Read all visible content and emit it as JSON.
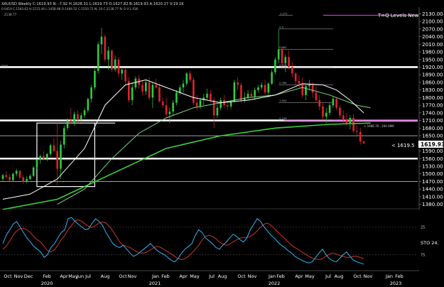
{
  "header": {
    "symbol_line": "XAUUSD Weekly  C:1619.93  N: -7.92  H:1628.31  L:1619.73  O:1627.82  B:1619.93  A:1620.27  V:19.1K",
    "ohlc_line": "0:0419  C:1583.63  H:1515.44  L:1458.98  O:1484.52  C:1550.71  N: 10  C:2138.77  N: 0  V:1.41K",
    "level_label": "2138.77"
  },
  "chart_title": "T=Q Levels New",
  "current_price_label": "< 1619.5",
  "current_price_box": "1619.93",
  "sma_label": "< 1686.76 - 200 SMA",
  "left_marker": "1900",
  "fib_labels": [
    "1.272",
    "0.5",
    "0.382",
    "0.618",
    "0.786",
    "1.000",
    "0.236"
  ],
  "stochastic_label": "STO 24.",
  "colors": {
    "background": "#000000",
    "up_candle": "#2ecc40",
    "down_candle": "#e0242c",
    "sma_fast": "#ffffff",
    "sma_mid": "#7fd77f",
    "sma_slow": "#3ad03a",
    "level_line": "#ffffff",
    "magenta_line": "#cc33cc",
    "stoch_k": "#29b6f6",
    "stoch_d": "#d32f2f"
  },
  "chart_data": {
    "type": "candlestick",
    "title": "T=Q Levels New",
    "symbol": "XAUUSD",
    "timeframe": "Weekly",
    "y_ticks": [
      2130,
      2100,
      2070,
      2040,
      2010,
      1980,
      1950,
      1920,
      1890,
      1860,
      1830,
      1800,
      1770,
      1740,
      1710,
      1680,
      1650,
      1620,
      1590,
      1560,
      1530,
      1500,
      1470,
      1440,
      1410,
      1380
    ],
    "ylim": [
      1365,
      2145
    ],
    "x_tick_labels": [
      "Oct",
      "Nov",
      "Dec",
      "Feb",
      "Apr",
      "May",
      "Jun",
      "Jul",
      "Aug",
      "Oct",
      "Nov",
      "Jan",
      "Feb",
      "Apr",
      "May",
      "Jul",
      "Aug",
      "Oct",
      "Nov",
      "Jan",
      "Feb",
      "Apr",
      "May",
      "Jul",
      "Aug",
      "Oct",
      "Nov",
      "Jan",
      "Feb"
    ],
    "year_labels": [
      "2020",
      "2021",
      "2022",
      "2023"
    ],
    "horizontal_levels": [
      1920,
      1710,
      1650,
      1560,
      1470
    ],
    "magenta_levels": [
      2124,
      1712
    ],
    "fib_levels": [
      2070,
      1990,
      1920,
      1850,
      1780,
      1710
    ],
    "boxes": [
      {
        "name": "box-2020-consolidation-left",
        "price_top": 1700,
        "price_bottom": 1450
      },
      {
        "name": "box-2020-consolidation-right",
        "price_top": 1700,
        "price_bottom": 1610
      }
    ],
    "ohlc": [
      [
        1480,
        1500,
        1470,
        1495
      ],
      [
        1495,
        1510,
        1480,
        1488
      ],
      [
        1488,
        1500,
        1470,
        1475
      ],
      [
        1475,
        1505,
        1470,
        1500
      ],
      [
        1500,
        1520,
        1490,
        1512
      ],
      [
        1512,
        1515,
        1480,
        1486
      ],
      [
        1486,
        1495,
        1460,
        1470
      ],
      [
        1470,
        1490,
        1462,
        1480
      ],
      [
        1480,
        1498,
        1475,
        1492
      ],
      [
        1492,
        1530,
        1488,
        1525
      ],
      [
        1525,
        1560,
        1520,
        1555
      ],
      [
        1555,
        1575,
        1540,
        1570
      ],
      [
        1570,
        1590,
        1555,
        1560
      ],
      [
        1560,
        1582,
        1550,
        1578
      ],
      [
        1578,
        1620,
        1570,
        1612
      ],
      [
        1612,
        1640,
        1585,
        1590
      ],
      [
        1590,
        1700,
        1455,
        1520
      ],
      [
        1520,
        1630,
        1480,
        1615
      ],
      [
        1615,
        1690,
        1600,
        1680
      ],
      [
        1680,
        1720,
        1670,
        1710
      ],
      [
        1710,
        1760,
        1695,
        1700
      ],
      [
        1700,
        1745,
        1690,
        1735
      ],
      [
        1735,
        1750,
        1700,
        1712
      ],
      [
        1712,
        1740,
        1705,
        1730
      ],
      [
        1730,
        1760,
        1720,
        1750
      ],
      [
        1750,
        1800,
        1740,
        1795
      ],
      [
        1795,
        1850,
        1780,
        1840
      ],
      [
        1840,
        1920,
        1830,
        1905
      ],
      [
        1905,
        2020,
        1895,
        2010
      ],
      [
        2010,
        2075,
        1970,
        2040
      ],
      [
        2040,
        2050,
        1940,
        1950
      ],
      [
        1950,
        2000,
        1910,
        1985
      ],
      [
        1985,
        1990,
        1900,
        1910
      ],
      [
        1910,
        1965,
        1900,
        1950
      ],
      [
        1950,
        1960,
        1880,
        1895
      ],
      [
        1895,
        1920,
        1870,
        1910
      ],
      [
        1910,
        1915,
        1850,
        1865
      ],
      [
        1865,
        1880,
        1780,
        1790
      ],
      [
        1790,
        1860,
        1770,
        1840
      ],
      [
        1840,
        1885,
        1830,
        1875
      ],
      [
        1875,
        1890,
        1835,
        1850
      ],
      [
        1850,
        1870,
        1810,
        1825
      ],
      [
        1825,
        1870,
        1810,
        1860
      ],
      [
        1860,
        1880,
        1790,
        1800
      ],
      [
        1800,
        1860,
        1760,
        1850
      ],
      [
        1850,
        1875,
        1835,
        1840
      ],
      [
        1840,
        1855,
        1780,
        1785
      ],
      [
        1785,
        1800,
        1760,
        1770
      ],
      [
        1770,
        1800,
        1720,
        1735
      ],
      [
        1735,
        1760,
        1700,
        1745
      ],
      [
        1745,
        1790,
        1730,
        1780
      ],
      [
        1780,
        1830,
        1770,
        1820
      ],
      [
        1820,
        1850,
        1810,
        1840
      ],
      [
        1840,
        1870,
        1820,
        1855
      ],
      [
        1855,
        1900,
        1845,
        1895
      ],
      [
        1895,
        1905,
        1860,
        1870
      ],
      [
        1870,
        1880,
        1770,
        1780
      ],
      [
        1780,
        1810,
        1750,
        1765
      ],
      [
        1765,
        1800,
        1755,
        1790
      ],
      [
        1790,
        1815,
        1770,
        1800
      ],
      [
        1800,
        1835,
        1790,
        1815
      ],
      [
        1815,
        1830,
        1780,
        1790
      ],
      [
        1790,
        1800,
        1680,
        1730
      ],
      [
        1730,
        1775,
        1720,
        1760
      ],
      [
        1760,
        1800,
        1750,
        1790
      ],
      [
        1790,
        1810,
        1760,
        1770
      ],
      [
        1770,
        1785,
        1750,
        1765
      ],
      [
        1765,
        1790,
        1755,
        1785
      ],
      [
        1785,
        1870,
        1780,
        1860
      ],
      [
        1860,
        1880,
        1830,
        1850
      ],
      [
        1850,
        1860,
        1780,
        1790
      ],
      [
        1790,
        1820,
        1780,
        1800
      ],
      [
        1800,
        1830,
        1790,
        1815
      ],
      [
        1815,
        1830,
        1800,
        1805
      ],
      [
        1805,
        1840,
        1790,
        1830
      ],
      [
        1830,
        1850,
        1820,
        1840
      ],
      [
        1840,
        1860,
        1830,
        1850
      ],
      [
        1850,
        1870,
        1810,
        1820
      ],
      [
        1820,
        1860,
        1800,
        1855
      ],
      [
        1855,
        1910,
        1850,
        1900
      ],
      [
        1900,
        1960,
        1890,
        1950
      ],
      [
        1950,
        2070,
        1935,
        1990
      ],
      [
        1990,
        2000,
        1920,
        1935
      ],
      [
        1935,
        1970,
        1900,
        1960
      ],
      [
        1960,
        1985,
        1910,
        1920
      ],
      [
        1920,
        1940,
        1880,
        1895
      ],
      [
        1895,
        1900,
        1850,
        1865
      ],
      [
        1865,
        1890,
        1840,
        1855
      ],
      [
        1855,
        1880,
        1800,
        1810
      ],
      [
        1810,
        1850,
        1790,
        1845
      ],
      [
        1845,
        1870,
        1830,
        1850
      ],
      [
        1850,
        1860,
        1800,
        1820
      ],
      [
        1820,
        1845,
        1780,
        1790
      ],
      [
        1790,
        1810,
        1750,
        1765
      ],
      [
        1765,
        1780,
        1715,
        1725
      ],
      [
        1725,
        1760,
        1700,
        1740
      ],
      [
        1740,
        1780,
        1730,
        1770
      ],
      [
        1770,
        1805,
        1760,
        1795
      ],
      [
        1795,
        1800,
        1750,
        1760
      ],
      [
        1760,
        1770,
        1720,
        1730
      ],
      [
        1730,
        1750,
        1700,
        1712
      ],
      [
        1712,
        1740,
        1690,
        1700
      ],
      [
        1700,
        1730,
        1675,
        1720
      ],
      [
        1720,
        1735,
        1660,
        1668
      ],
      [
        1668,
        1690,
        1650,
        1665
      ],
      [
        1665,
        1680,
        1615,
        1628
      ],
      [
        1628,
        1630,
        1618,
        1620
      ]
    ],
    "sma_fast": [
      [
        0,
        1400
      ],
      [
        8,
        1420
      ],
      [
        16,
        1480
      ],
      [
        24,
        1600
      ],
      [
        30,
        1770
      ],
      [
        36,
        1850
      ],
      [
        42,
        1870
      ],
      [
        48,
        1840
      ],
      [
        56,
        1800
      ],
      [
        64,
        1780
      ],
      [
        72,
        1790
      ],
      [
        80,
        1810
      ],
      [
        88,
        1855
      ],
      [
        94,
        1850
      ],
      [
        98,
        1830
      ],
      [
        102,
        1790
      ],
      [
        106,
        1740
      ]
    ],
    "sma_mid": [
      [
        16,
        1380
      ],
      [
        24,
        1440
      ],
      [
        32,
        1560
      ],
      [
        40,
        1660
      ],
      [
        48,
        1720
      ],
      [
        56,
        1760
      ],
      [
        64,
        1780
      ],
      [
        72,
        1800
      ],
      [
        80,
        1810
      ],
      [
        88,
        1840
      ],
      [
        96,
        1810
      ],
      [
        104,
        1770
      ],
      [
        108,
        1760
      ]
    ],
    "sma_slow": [
      [
        0,
        1360
      ],
      [
        16,
        1400
      ],
      [
        32,
        1500
      ],
      [
        48,
        1600
      ],
      [
        64,
        1650
      ],
      [
        80,
        1680
      ],
      [
        96,
        1695
      ],
      [
        108,
        1700
      ]
    ],
    "stochastic": {
      "ylim": [
        0,
        100
      ],
      "gridlines": [
        75,
        25
      ],
      "tick_labels": [
        "25.",
        "75."
      ],
      "k": [
        45,
        60,
        70,
        80,
        85,
        75,
        65,
        55,
        48,
        40,
        35,
        30,
        20,
        25,
        38,
        45,
        55,
        65,
        70,
        90,
        92,
        85,
        80,
        75,
        70,
        72,
        82,
        90,
        85,
        78,
        65,
        55,
        45,
        40,
        38,
        42,
        35,
        28,
        22,
        25,
        30,
        35,
        40,
        45,
        38,
        32,
        28,
        25,
        20,
        15,
        12,
        18,
        28,
        35,
        40,
        45,
        60,
        70,
        65,
        55,
        50,
        45,
        38,
        35,
        42,
        48,
        55,
        62,
        58,
        52,
        48,
        55,
        70,
        80,
        90,
        85,
        75,
        68,
        60,
        55,
        48,
        42,
        38,
        32,
        28,
        22,
        18,
        15,
        12,
        10,
        12,
        20,
        28,
        35,
        25,
        18,
        14,
        12,
        18,
        25,
        30,
        22,
        15,
        12,
        10,
        8
      ],
      "d": [
        35,
        40,
        50,
        60,
        68,
        72,
        73,
        70,
        65,
        58,
        52,
        48,
        40,
        32,
        30,
        34,
        42,
        52,
        60,
        70,
        78,
        86,
        88,
        85,
        80,
        76,
        74,
        78,
        82,
        84,
        82,
        76,
        68,
        58,
        48,
        42,
        40,
        38,
        34,
        30,
        28,
        28,
        30,
        34,
        38,
        40,
        38,
        34,
        30,
        26,
        22,
        18,
        16,
        18,
        22,
        28,
        35,
        42,
        52,
        58,
        60,
        58,
        54,
        48,
        44,
        42,
        44,
        48,
        52,
        55,
        56,
        56,
        58,
        62,
        68,
        75,
        80,
        82,
        78,
        72,
        66,
        60,
        54,
        48,
        42,
        38,
        34,
        30,
        26,
        22,
        19,
        17,
        16,
        18,
        22,
        26,
        28,
        26,
        24,
        22,
        20,
        20,
        22,
        22,
        20,
        18
      ]
    }
  }
}
